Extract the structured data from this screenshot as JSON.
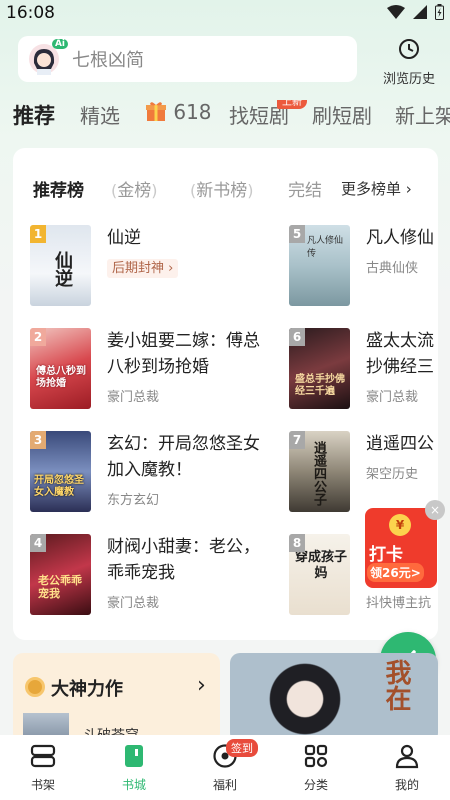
{
  "status": {
    "time": "16:08"
  },
  "search": {
    "placeholder": "七根凶简",
    "avatar_badge": "Ai"
  },
  "header": {
    "history_label": "浏览历史"
  },
  "tabs": [
    {
      "label": "推荐"
    },
    {
      "label": "精选"
    },
    {
      "label": "618"
    },
    {
      "label": "找短剧",
      "badge": "上新"
    },
    {
      "label": "刷短剧"
    },
    {
      "label": "新上架"
    }
  ],
  "rank": {
    "tabs": [
      "推荐榜",
      "金榜",
      "新书榜",
      "完结"
    ],
    "more_label": "更多榜单"
  },
  "books": [
    {
      "rank": "1",
      "title": "仙逆",
      "tag": "后期封神",
      "cover_text": "仙逆"
    },
    {
      "rank": "2",
      "title": "姜小姐要二嫁：傅总",
      "title2": "八秒到场抢婚",
      "tag": "豪门总裁",
      "cover_text": "傅总八秒到场抢婚"
    },
    {
      "rank": "3",
      "title": "玄幻：开局忽悠圣女",
      "title2": "加入魔教！",
      "tag": "东方玄幻",
      "cover_text": "开局忽悠圣女入魔教"
    },
    {
      "rank": "4",
      "title": "财阀小甜妻：老公，",
      "title2": "乖乖宠我",
      "tag": "豪门总裁",
      "cover_text": "老公乖乖宠我"
    },
    {
      "rank": "5",
      "title": "凡人修仙",
      "tag": "古典仙侠",
      "cover_text": "凡人修仙传"
    },
    {
      "rank": "6",
      "title": "盛太太流",
      "title2": "抄佛经三",
      "tag": "豪门总裁",
      "cover_text": "盛总手抄佛经三千遍"
    },
    {
      "rank": "7",
      "title": "逍遥四公",
      "tag": "架空历史",
      "cover_text": "逍遥四公子"
    },
    {
      "rank": "8",
      "title": "抖快博主抗",
      "tag": "",
      "cover_text": "穿成孩子妈"
    }
  ],
  "promo": {
    "label": "打卡",
    "amount": "领26元>",
    "coin": "¥",
    "close": "×"
  },
  "god_card": {
    "title": "大神力作",
    "subtitle": "斗破苍穹",
    "arrow": "›"
  },
  "banner": {
    "text": "我在"
  },
  "nav": [
    {
      "label": "书架"
    },
    {
      "label": "书城"
    },
    {
      "label": "福利",
      "badge": "签到"
    },
    {
      "label": "分类"
    },
    {
      "label": "我的"
    }
  ],
  "colors": {
    "accent": "#2eb872",
    "rank_1": "#f2b531",
    "rank_2": "#f0a99c",
    "rank_3": "#e3aa72",
    "rank_other": "#a8a8a8"
  }
}
